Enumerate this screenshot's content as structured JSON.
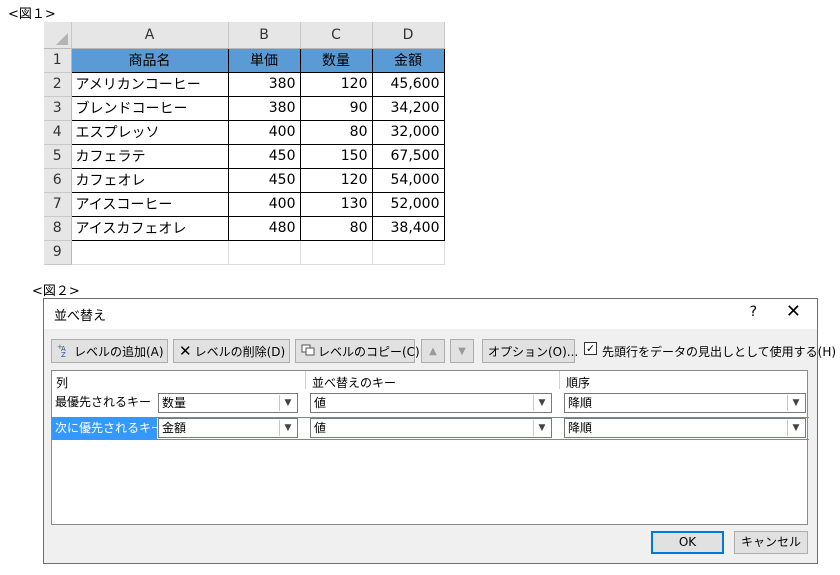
{
  "figures": {
    "fig1_label": "<図１>",
    "fig2_label": "<図２>"
  },
  "sheet": {
    "columns": [
      "A",
      "B",
      "C",
      "D"
    ],
    "row_numbers": [
      "1",
      "2",
      "3",
      "4",
      "5",
      "6",
      "7",
      "8",
      "9"
    ],
    "headers": [
      "商品名",
      "単価",
      "数量",
      "金額"
    ],
    "rows": [
      [
        "アメリカンコーヒー",
        "380",
        "120",
        "45,600"
      ],
      [
        "ブレンドコーヒー",
        "380",
        "90",
        "34,200"
      ],
      [
        "エスプレッソ",
        "400",
        "80",
        "32,000"
      ],
      [
        "カフェラテ",
        "450",
        "150",
        "67,500"
      ],
      [
        "カフェオレ",
        "450",
        "120",
        "54,000"
      ],
      [
        "アイスコーヒー",
        "400",
        "130",
        "52,000"
      ],
      [
        "アイスカフェオレ",
        "480",
        "80",
        "38,400"
      ]
    ]
  },
  "dialog": {
    "title": "並べ替え",
    "help": "?",
    "close": "✕",
    "toolbar": {
      "add_level": "レベルの追加(A)",
      "delete_level": "レベルの削除(D)",
      "copy_level": "レベルのコピー(C)",
      "move_up": "▲",
      "move_down": "▼",
      "options": "オプション(O)...",
      "header_checkbox_label": "先頭行をデータの見出しとして使用する(H)",
      "header_checked": true
    },
    "grid_headers": {
      "column": "列",
      "sort_on": "並べ替えのキー",
      "order": "順序"
    },
    "levels": [
      {
        "label": "最優先されるキー",
        "column": "数量",
        "sort_on": "値",
        "order": "降順"
      },
      {
        "label": "次に優先されるキー",
        "column": "金額",
        "sort_on": "値",
        "order": "降順"
      }
    ],
    "ok": "OK",
    "cancel": "キャンセル"
  },
  "colors": {
    "header_fill": "#5b9bd5",
    "selection": "#3399ff",
    "default_button_border": "#0078d7"
  },
  "icons": [
    "add-level-icon",
    "delete-level-icon",
    "copy-level-icon",
    "check-icon",
    "chevron-down-icon"
  ]
}
